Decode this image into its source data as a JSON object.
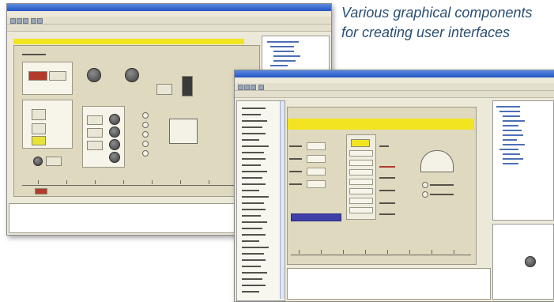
{
  "caption": {
    "line1": "Various graphical components",
    "line2": "for creating user interfaces"
  },
  "screenshots": {
    "back": {
      "title": ""
    },
    "front": {
      "title": ""
    }
  },
  "colors": {
    "caption_text": "#2a4f73",
    "window_bg": "#ece9d8",
    "title_bar": "#2454c4",
    "highlight_bar": "#f2e421",
    "selection": "#3f3fa8"
  }
}
